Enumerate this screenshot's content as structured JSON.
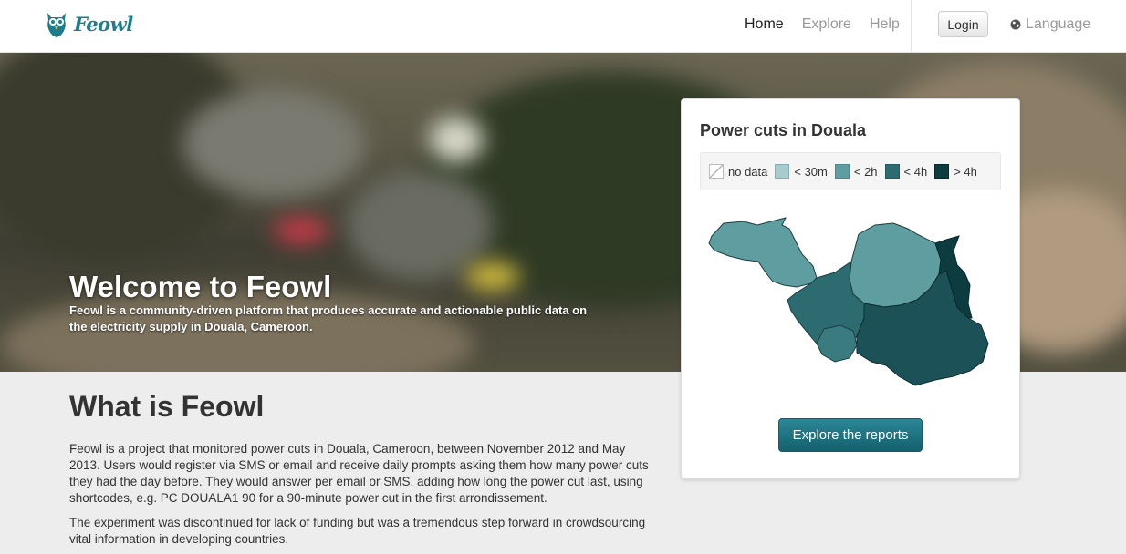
{
  "brand": {
    "name": "Feowl"
  },
  "nav": {
    "items": [
      {
        "label": "Home",
        "active": true
      },
      {
        "label": "Explore",
        "active": false
      },
      {
        "label": "Help",
        "active": false
      }
    ],
    "login_label": "Login",
    "language_label": "Language"
  },
  "hero": {
    "title": "Welcome to Feowl",
    "subtitle": "Feowl is a community-driven platform that produces accurate and actionable public data on the electricity supply in Douala, Cameroon."
  },
  "about": {
    "title": "What is Feowl",
    "paragraphs": [
      "Feowl is a project that monitored power cuts in Douala, Cameroon, between November 2012 and May 2013. Users would register via SMS or email and receive daily prompts asking them how many power cuts they had the day before. They would answer per email or SMS, adding how long the power cut last, using shortcodes, e.g. PC DOUALA1 90 for a 90-minute power cut in the first arrondissement.",
      "The experiment was discontinued for lack of funding but was a tremendous step forward in crowdsourcing vital information in developing countries."
    ]
  },
  "map_card": {
    "title": "Power cuts in Douala",
    "legend": [
      {
        "label": "no data",
        "color": "#ffffff"
      },
      {
        "label": "< 30m",
        "color": "#a6ccce"
      },
      {
        "label": "< 2h",
        "color": "#5e9ea0"
      },
      {
        "label": "< 4h",
        "color": "#2c6b70"
      },
      {
        "label": "> 4h",
        "color": "#0c3b40"
      }
    ],
    "button_label": "Explore the reports"
  },
  "colors": {
    "brand": "#1d7d8a",
    "button": "#1b6d7b"
  }
}
